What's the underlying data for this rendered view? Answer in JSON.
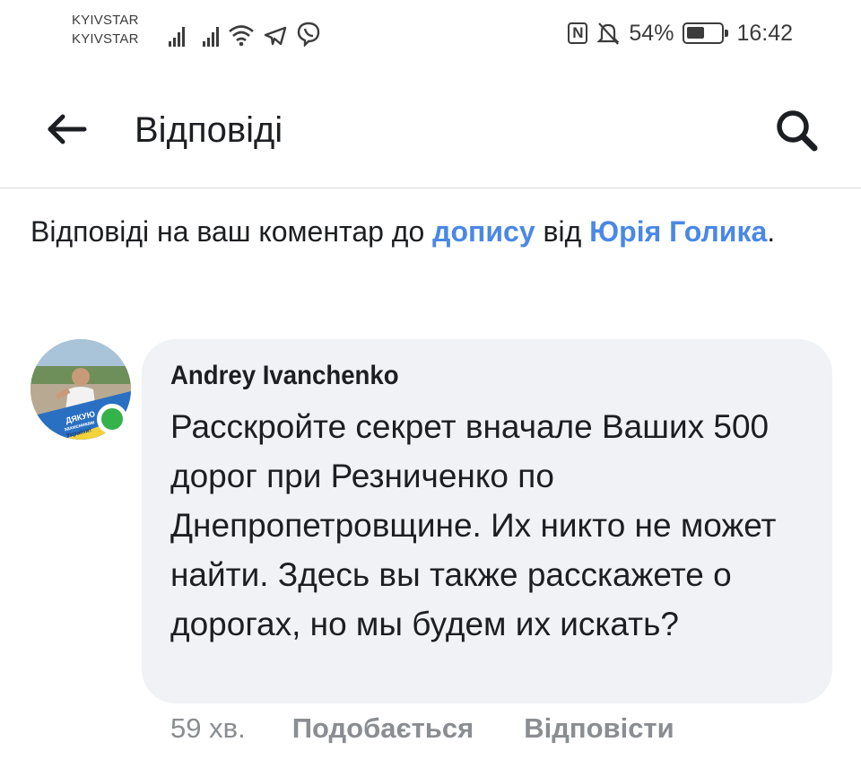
{
  "status_bar": {
    "carrier1": "KYIVSTAR",
    "carrier2": "KYIVSTAR",
    "battery": "54%",
    "battery_level": 0.54,
    "time": "16:42"
  },
  "header": {
    "title": "Відповіді"
  },
  "intro": {
    "prefix": "Відповіді на ваш коментар до ",
    "post_link": "допису",
    "middle": " від ",
    "author_link": "Юрія Голика",
    "suffix": "."
  },
  "comment": {
    "author": "Andrey  Ivanchenko",
    "text": "Расскройте секрет вначале Ваших 500 дорог при Резниченко по Днепропетровщине. Их никто не может найти. Здесь вы также расскажете о дорогах, но мы будем их искать?",
    "avatar_badge": [
      "ДЯКУЮ",
      "захисникам",
      "України!"
    ],
    "time": "59 хв.",
    "like_label": "Подобається",
    "reply_label": "Відповісти"
  },
  "colors": {
    "link": "#4a88e6",
    "bubble": "#f0f2f5",
    "meta": "#8a8d91",
    "online": "#35b24a"
  },
  "icons": [
    "signal-icon",
    "wifi-icon",
    "telegram-icon",
    "viber-icon",
    "nfc-icon",
    "mute-icon",
    "battery-icon",
    "back-arrow-icon",
    "search-icon"
  ]
}
